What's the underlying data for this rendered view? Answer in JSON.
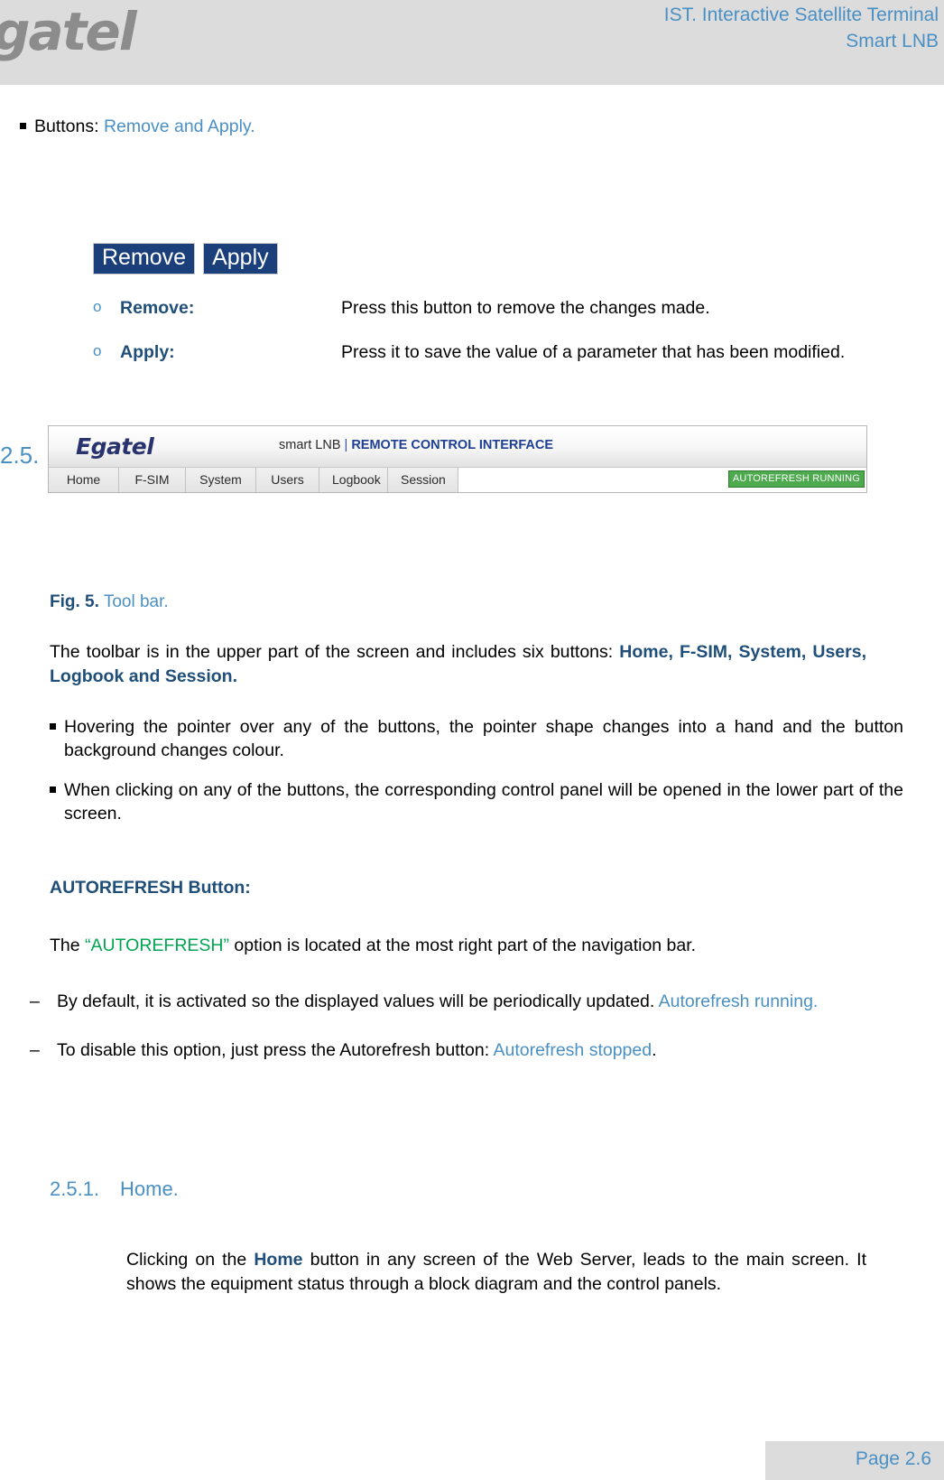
{
  "header": {
    "logo_text": "gatel",
    "title_line1": "IST. Interactive Satellite Terminal",
    "title_line2": "Smart LNB"
  },
  "buttons_section": {
    "intro_prefix": "Buttons: ",
    "intro_highlight": "Remove and Apply.",
    "ui_buttons": [
      {
        "label": "Remove"
      },
      {
        "label": "Apply"
      }
    ],
    "definitions": [
      {
        "term": "Remove",
        "term_suffix": ":",
        "body": "Press this button to remove the changes made."
      },
      {
        "term": "Apply:",
        "term_suffix": "",
        "body": "Press it to save the value of a parameter that has been modified."
      }
    ]
  },
  "section_25": {
    "number": "2.5.",
    "title": "Tool bar"
  },
  "figure": {
    "brand": "Egatel",
    "subtitle_plain": "smart LNB",
    "subtitle_sep": " | ",
    "subtitle_bold": "REMOTE CONTROL INTERFACE",
    "nav_items": [
      "Home",
      "F-SIM",
      "System",
      "Users",
      "Logbook",
      "Session"
    ],
    "autorefresh_badge": "AUTOREFRESH RUNNING",
    "caption_label": "Fig. 5.",
    "caption_text": " Tool bar."
  },
  "toolbar_paragraph": {
    "lead": "The toolbar is in the upper part of the screen and includes six buttons: ",
    "bold": "Home, F-SIM, System, Users, Logbook and Session."
  },
  "toolbar_bullets": [
    "Hovering the pointer over any of the buttons, the pointer shape changes into a hand and the button background changes colour.",
    "When clicking on any of the buttons, the corresponding control panel will be opened in the lower part of the screen."
  ],
  "autorefresh_section": {
    "heading": "AUTOREFRESH Button:",
    "para_pre": "The ",
    "para_green": "“AUTOREFRESH”",
    "para_post": " option is located at the most right part of the navigation bar.",
    "items": [
      {
        "text": "By default, it is activated so the displayed values will be periodically updated. ",
        "highlight": "Autorefresh running.",
        "tail": ""
      },
      {
        "text": "To disable this option, just press the Autorefresh button: ",
        "highlight": "Autorefresh stopped",
        "tail": "."
      }
    ]
  },
  "section_251": {
    "number": "2.5.1.",
    "title": "Home.",
    "body_pre": "Clicking on the ",
    "body_bold": "Home",
    "body_post": " button in any screen of the Web Server, leads to the main screen. It shows the equipment status through a block diagram and the control panels."
  },
  "footer": {
    "page_label": "Page 2.6"
  },
  "colors": {
    "accent_blue": "#4a90c4",
    "navy": "#1f4e79",
    "green": "#00a651",
    "button_blue": "#1a3f7a",
    "badge_green": "#4eaa4e",
    "header_gray": "#dcdcdc"
  }
}
